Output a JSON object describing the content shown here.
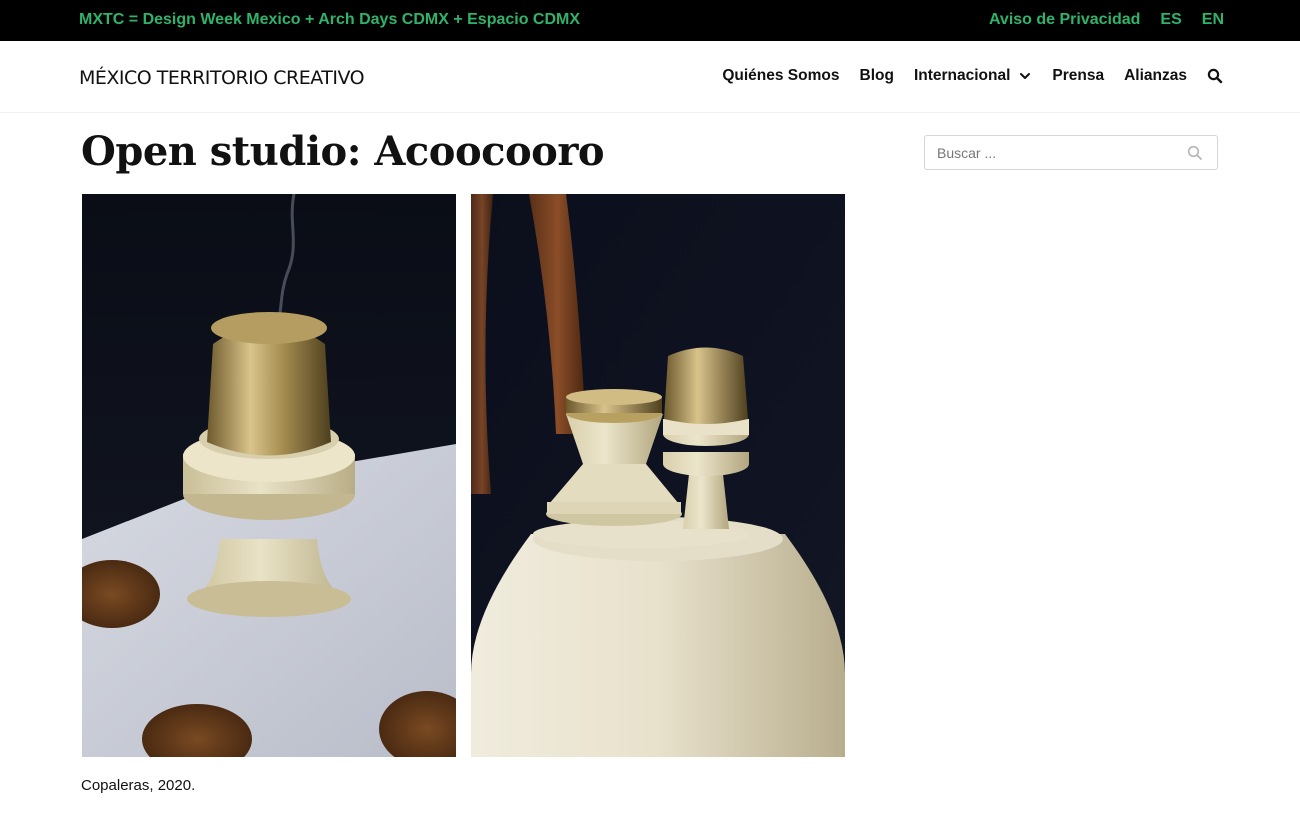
{
  "topbar": {
    "promo": "MXTC = Design Week Mexico + Arch Days CDMX + Espacio CDMX",
    "privacy": "Aviso de Privacidad",
    "lang_es": "ES",
    "lang_en": "EN",
    "accent_color": "#2fb36b"
  },
  "header": {
    "logo": "MÉXICO TERRITORIO CREATIVO",
    "nav": {
      "about": "Quiénes Somos",
      "blog": "Blog",
      "international": "Internacional",
      "press": "Prensa",
      "alliances": "Alianzas"
    }
  },
  "main": {
    "title": "Open studio: Acoocooro",
    "caption": "Copaleras, 2020."
  },
  "sidebar": {
    "search_placeholder": "Buscar ..."
  },
  "icons": {
    "dropdown": "chevron-down-icon",
    "header_search": "search-icon",
    "sidebar_search": "search-icon"
  }
}
